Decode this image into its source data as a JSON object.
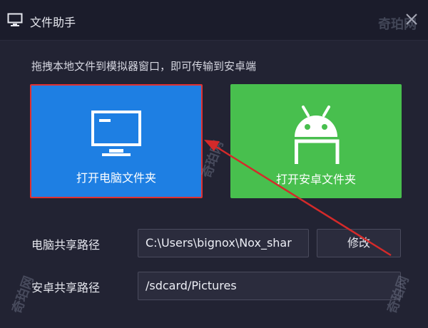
{
  "window": {
    "title": "文件助手",
    "hint": "拖拽本地文件到模拟器窗口，即可传输到安卓端"
  },
  "cards": {
    "pc": {
      "label": "打开电脑文件夹",
      "icon": "monitor-icon"
    },
    "android": {
      "label": "打开安卓文件夹",
      "icon": "android-icon"
    }
  },
  "share": {
    "pc_label": "电脑共享路径",
    "pc_value": "C:\\Users\\bignox\\Nox_shar",
    "modify_label": "修改",
    "android_label": "安卓共享路径",
    "android_value": "/sdcard/Pictures"
  },
  "watermarks": [
    "奇珀网",
    "奇珀网",
    "奇珀网",
    "奇珀网"
  ],
  "colors": {
    "pc_card": "#1e7fe3",
    "android_card": "#48bf4e",
    "highlight": "#e03131",
    "background": "#222333"
  }
}
